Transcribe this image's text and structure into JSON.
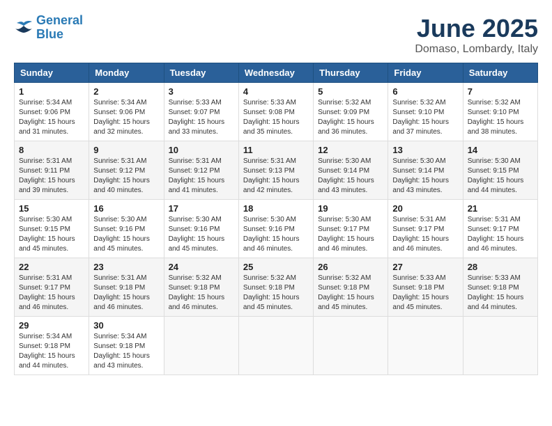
{
  "logo": {
    "line1": "General",
    "line2": "Blue"
  },
  "title": "June 2025",
  "location": "Domaso, Lombardy, Italy",
  "headers": [
    "Sunday",
    "Monday",
    "Tuesday",
    "Wednesday",
    "Thursday",
    "Friday",
    "Saturday"
  ],
  "weeks": [
    [
      {
        "day": "1",
        "sunrise": "5:34 AM",
        "sunset": "9:06 PM",
        "daylight": "15 hours and 31 minutes."
      },
      {
        "day": "2",
        "sunrise": "5:34 AM",
        "sunset": "9:06 PM",
        "daylight": "15 hours and 32 minutes."
      },
      {
        "day": "3",
        "sunrise": "5:33 AM",
        "sunset": "9:07 PM",
        "daylight": "15 hours and 33 minutes."
      },
      {
        "day": "4",
        "sunrise": "5:33 AM",
        "sunset": "9:08 PM",
        "daylight": "15 hours and 35 minutes."
      },
      {
        "day": "5",
        "sunrise": "5:32 AM",
        "sunset": "9:09 PM",
        "daylight": "15 hours and 36 minutes."
      },
      {
        "day": "6",
        "sunrise": "5:32 AM",
        "sunset": "9:10 PM",
        "daylight": "15 hours and 37 minutes."
      },
      {
        "day": "7",
        "sunrise": "5:32 AM",
        "sunset": "9:10 PM",
        "daylight": "15 hours and 38 minutes."
      }
    ],
    [
      {
        "day": "8",
        "sunrise": "5:31 AM",
        "sunset": "9:11 PM",
        "daylight": "15 hours and 39 minutes."
      },
      {
        "day": "9",
        "sunrise": "5:31 AM",
        "sunset": "9:12 PM",
        "daylight": "15 hours and 40 minutes."
      },
      {
        "day": "10",
        "sunrise": "5:31 AM",
        "sunset": "9:12 PM",
        "daylight": "15 hours and 41 minutes."
      },
      {
        "day": "11",
        "sunrise": "5:31 AM",
        "sunset": "9:13 PM",
        "daylight": "15 hours and 42 minutes."
      },
      {
        "day": "12",
        "sunrise": "5:30 AM",
        "sunset": "9:14 PM",
        "daylight": "15 hours and 43 minutes."
      },
      {
        "day": "13",
        "sunrise": "5:30 AM",
        "sunset": "9:14 PM",
        "daylight": "15 hours and 43 minutes."
      },
      {
        "day": "14",
        "sunrise": "5:30 AM",
        "sunset": "9:15 PM",
        "daylight": "15 hours and 44 minutes."
      }
    ],
    [
      {
        "day": "15",
        "sunrise": "5:30 AM",
        "sunset": "9:15 PM",
        "daylight": "15 hours and 45 minutes."
      },
      {
        "day": "16",
        "sunrise": "5:30 AM",
        "sunset": "9:16 PM",
        "daylight": "15 hours and 45 minutes."
      },
      {
        "day": "17",
        "sunrise": "5:30 AM",
        "sunset": "9:16 PM",
        "daylight": "15 hours and 45 minutes."
      },
      {
        "day": "18",
        "sunrise": "5:30 AM",
        "sunset": "9:16 PM",
        "daylight": "15 hours and 46 minutes."
      },
      {
        "day": "19",
        "sunrise": "5:30 AM",
        "sunset": "9:17 PM",
        "daylight": "15 hours and 46 minutes."
      },
      {
        "day": "20",
        "sunrise": "5:31 AM",
        "sunset": "9:17 PM",
        "daylight": "15 hours and 46 minutes."
      },
      {
        "day": "21",
        "sunrise": "5:31 AM",
        "sunset": "9:17 PM",
        "daylight": "15 hours and 46 minutes."
      }
    ],
    [
      {
        "day": "22",
        "sunrise": "5:31 AM",
        "sunset": "9:17 PM",
        "daylight": "15 hours and 46 minutes."
      },
      {
        "day": "23",
        "sunrise": "5:31 AM",
        "sunset": "9:18 PM",
        "daylight": "15 hours and 46 minutes."
      },
      {
        "day": "24",
        "sunrise": "5:32 AM",
        "sunset": "9:18 PM",
        "daylight": "15 hours and 46 minutes."
      },
      {
        "day": "25",
        "sunrise": "5:32 AM",
        "sunset": "9:18 PM",
        "daylight": "15 hours and 45 minutes."
      },
      {
        "day": "26",
        "sunrise": "5:32 AM",
        "sunset": "9:18 PM",
        "daylight": "15 hours and 45 minutes."
      },
      {
        "day": "27",
        "sunrise": "5:33 AM",
        "sunset": "9:18 PM",
        "daylight": "15 hours and 45 minutes."
      },
      {
        "day": "28",
        "sunrise": "5:33 AM",
        "sunset": "9:18 PM",
        "daylight": "15 hours and 44 minutes."
      }
    ],
    [
      {
        "day": "29",
        "sunrise": "5:34 AM",
        "sunset": "9:18 PM",
        "daylight": "15 hours and 44 minutes."
      },
      {
        "day": "30",
        "sunrise": "5:34 AM",
        "sunset": "9:18 PM",
        "daylight": "15 hours and 43 minutes."
      },
      null,
      null,
      null,
      null,
      null
    ]
  ]
}
